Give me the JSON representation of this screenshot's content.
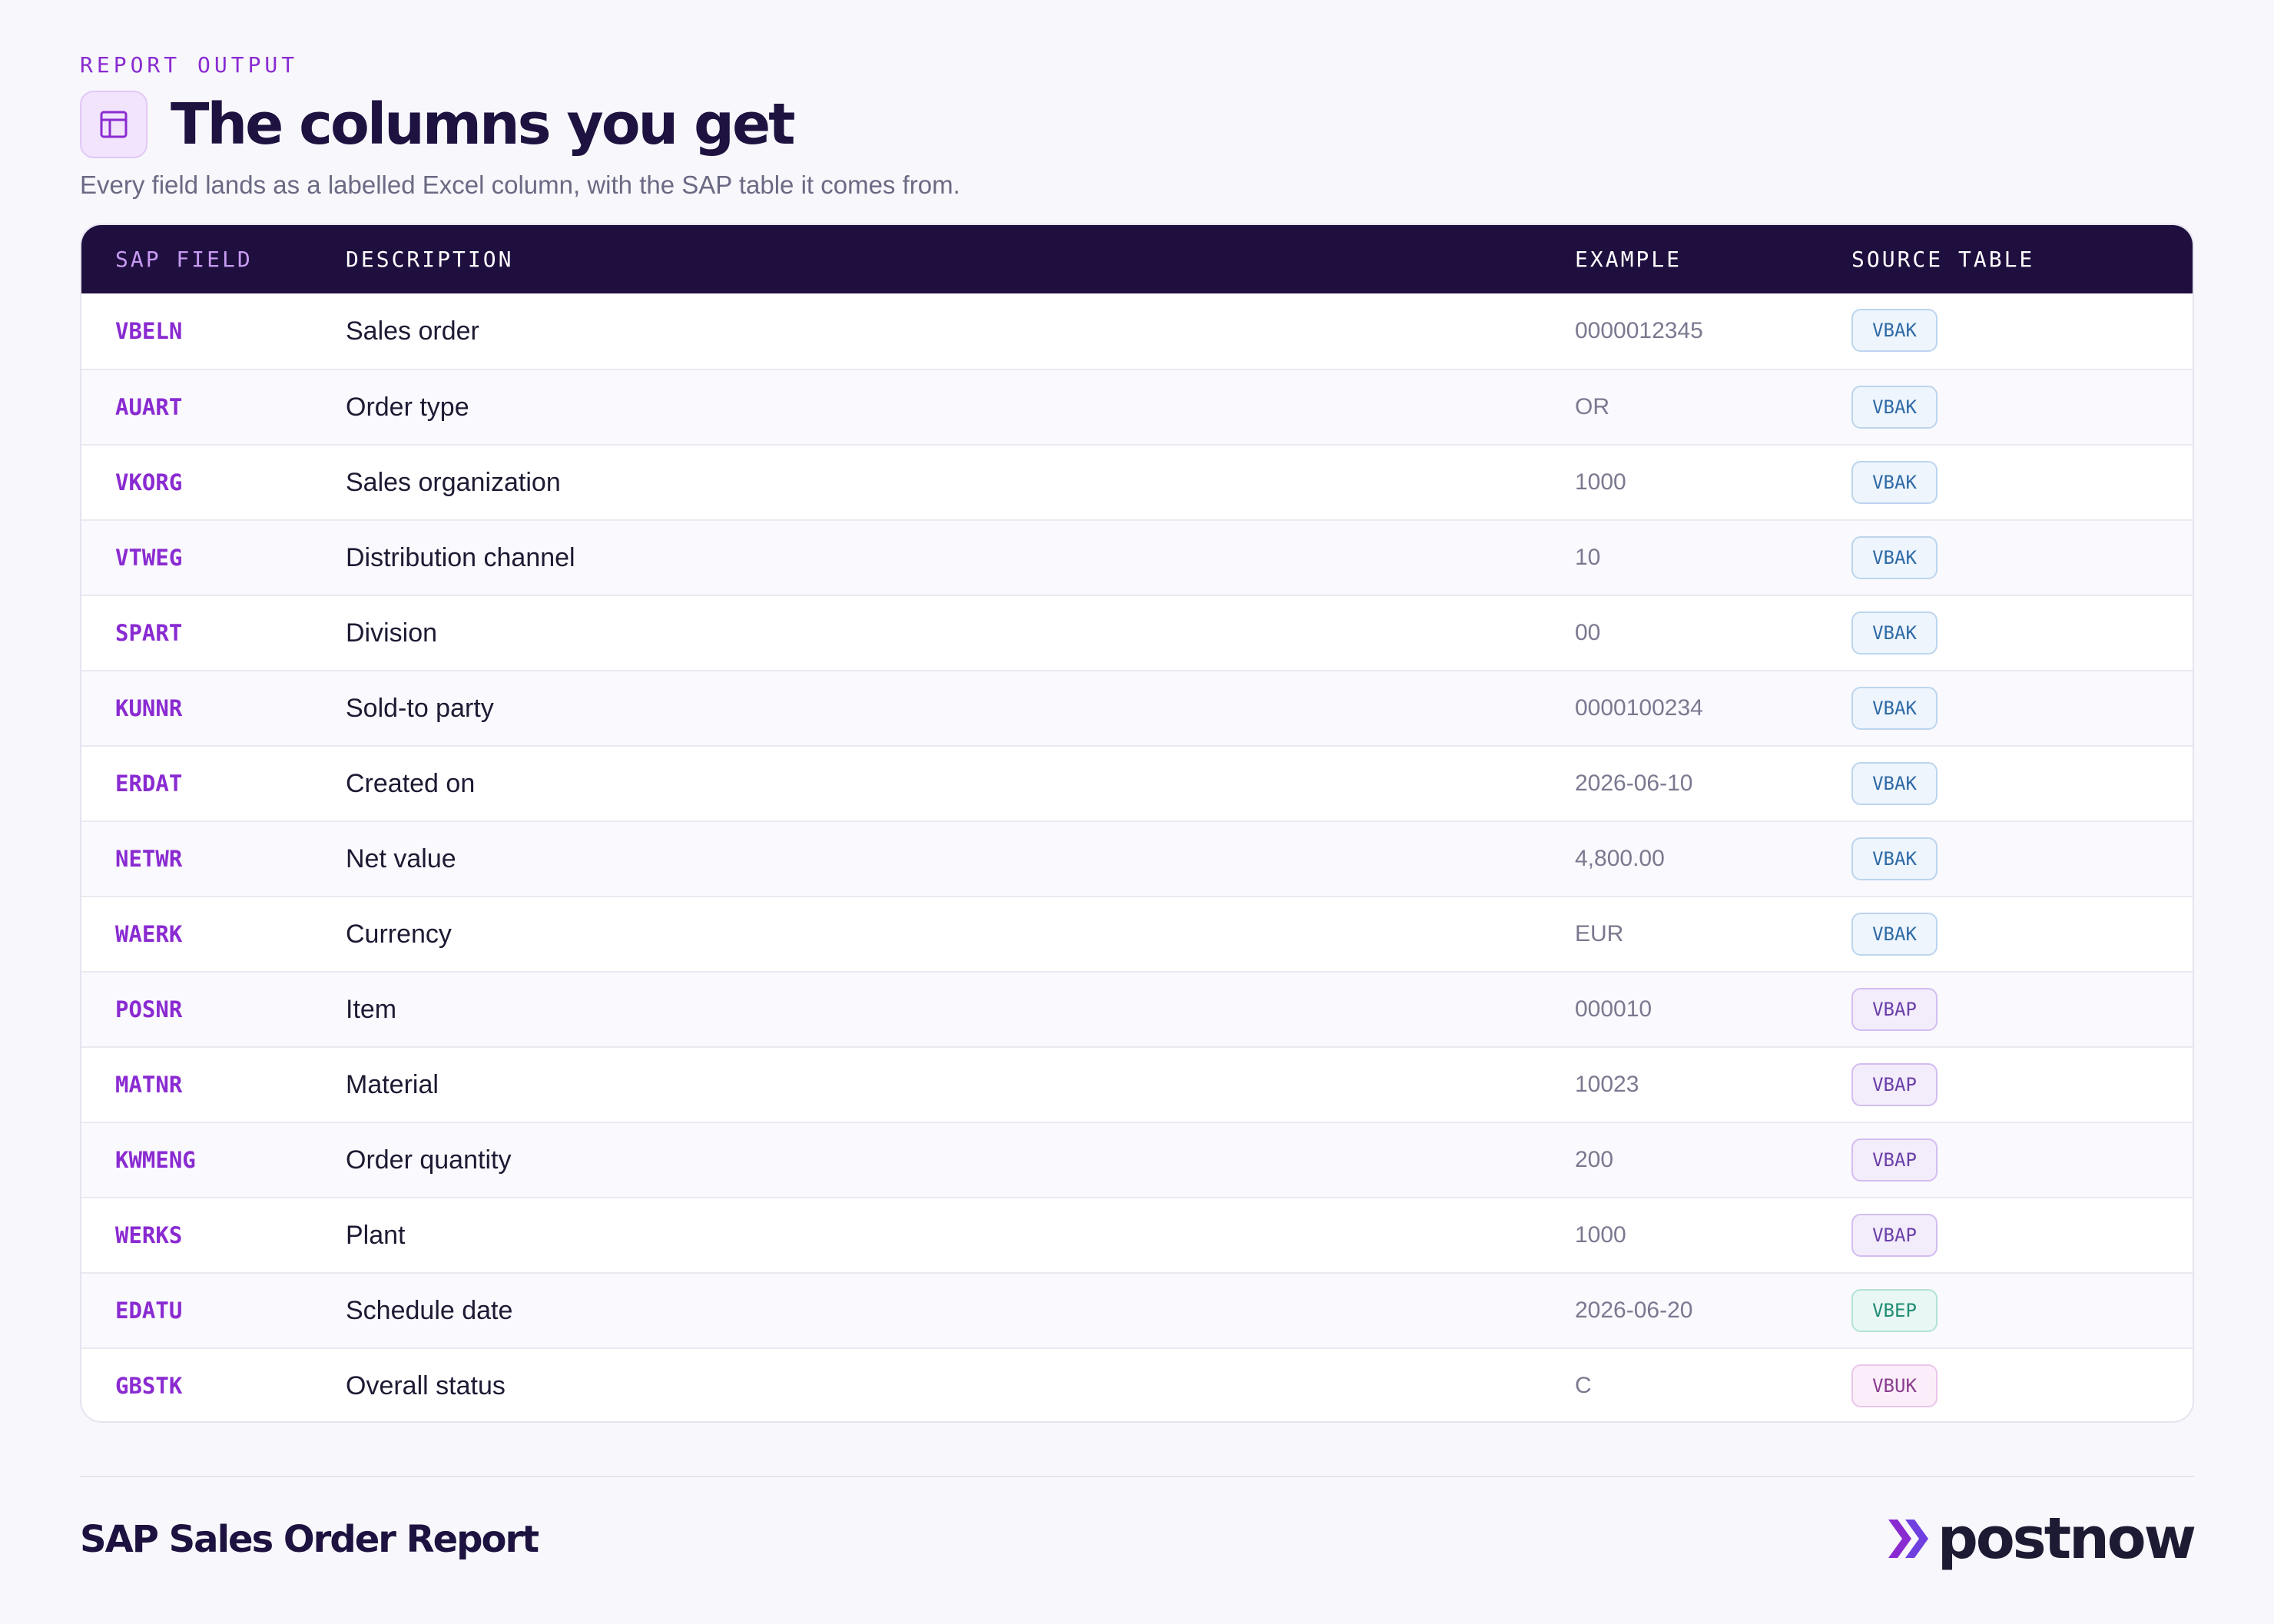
{
  "header": {
    "eyebrow": "REPORT OUTPUT",
    "title": "The columns you get",
    "title_icon": "table-layout-icon",
    "subtitle": "Every field lands as a labelled Excel column, with the SAP table it comes from."
  },
  "table": {
    "columns": [
      "SAP FIELD",
      "DESCRIPTION",
      "EXAMPLE",
      "SOURCE TABLE"
    ],
    "rows": [
      {
        "field": "VBELN",
        "description": "Sales order",
        "example": "0000012345",
        "source": "VBAK"
      },
      {
        "field": "AUART",
        "description": "Order type",
        "example": "OR",
        "source": "VBAK"
      },
      {
        "field": "VKORG",
        "description": "Sales organization",
        "example": "1000",
        "source": "VBAK"
      },
      {
        "field": "VTWEG",
        "description": "Distribution channel",
        "example": "10",
        "source": "VBAK"
      },
      {
        "field": "SPART",
        "description": "Division",
        "example": "00",
        "source": "VBAK"
      },
      {
        "field": "KUNNR",
        "description": "Sold-to party",
        "example": "0000100234",
        "source": "VBAK"
      },
      {
        "field": "ERDAT",
        "description": "Created on",
        "example": "2026-06-10",
        "source": "VBAK"
      },
      {
        "field": "NETWR",
        "description": "Net value",
        "example": "4,800.00",
        "source": "VBAK"
      },
      {
        "field": "WAERK",
        "description": "Currency",
        "example": "EUR",
        "source": "VBAK"
      },
      {
        "field": "POSNR",
        "description": "Item",
        "example": "000010",
        "source": "VBAP"
      },
      {
        "field": "MATNR",
        "description": "Material",
        "example": "10023",
        "source": "VBAP"
      },
      {
        "field": "KWMENG",
        "description": "Order quantity",
        "example": "200",
        "source": "VBAP"
      },
      {
        "field": "WERKS",
        "description": "Plant",
        "example": "1000",
        "source": "VBAP"
      },
      {
        "field": "EDATU",
        "description": "Schedule date",
        "example": "2026-06-20",
        "source": "VBEP"
      },
      {
        "field": "GBSTK",
        "description": "Overall status",
        "example": "C",
        "source": "VBUK"
      }
    ]
  },
  "badge_colors": {
    "VBAK": {
      "bg": "#eef5fc",
      "border": "#bcd5ee",
      "text": "#2f6aa6"
    },
    "VBAP": {
      "bg": "#f3ecfb",
      "border": "#d3bdf0",
      "text": "#6a3fa8"
    },
    "VBEP": {
      "bg": "#e8f7f3",
      "border": "#b3e2d6",
      "text": "#1f8c74"
    },
    "VBUK": {
      "bg": "#fbeefa",
      "border": "#e9c6ea",
      "text": "#8a3d8f"
    }
  },
  "footer": {
    "title": "SAP Sales Order Report",
    "brand": "postnow",
    "brand_icon": "double-chevron-right-icon"
  },
  "colors": {
    "accent": "#8a2bd1",
    "header_bg": "#1f0f3f",
    "title": "#1d1240"
  }
}
